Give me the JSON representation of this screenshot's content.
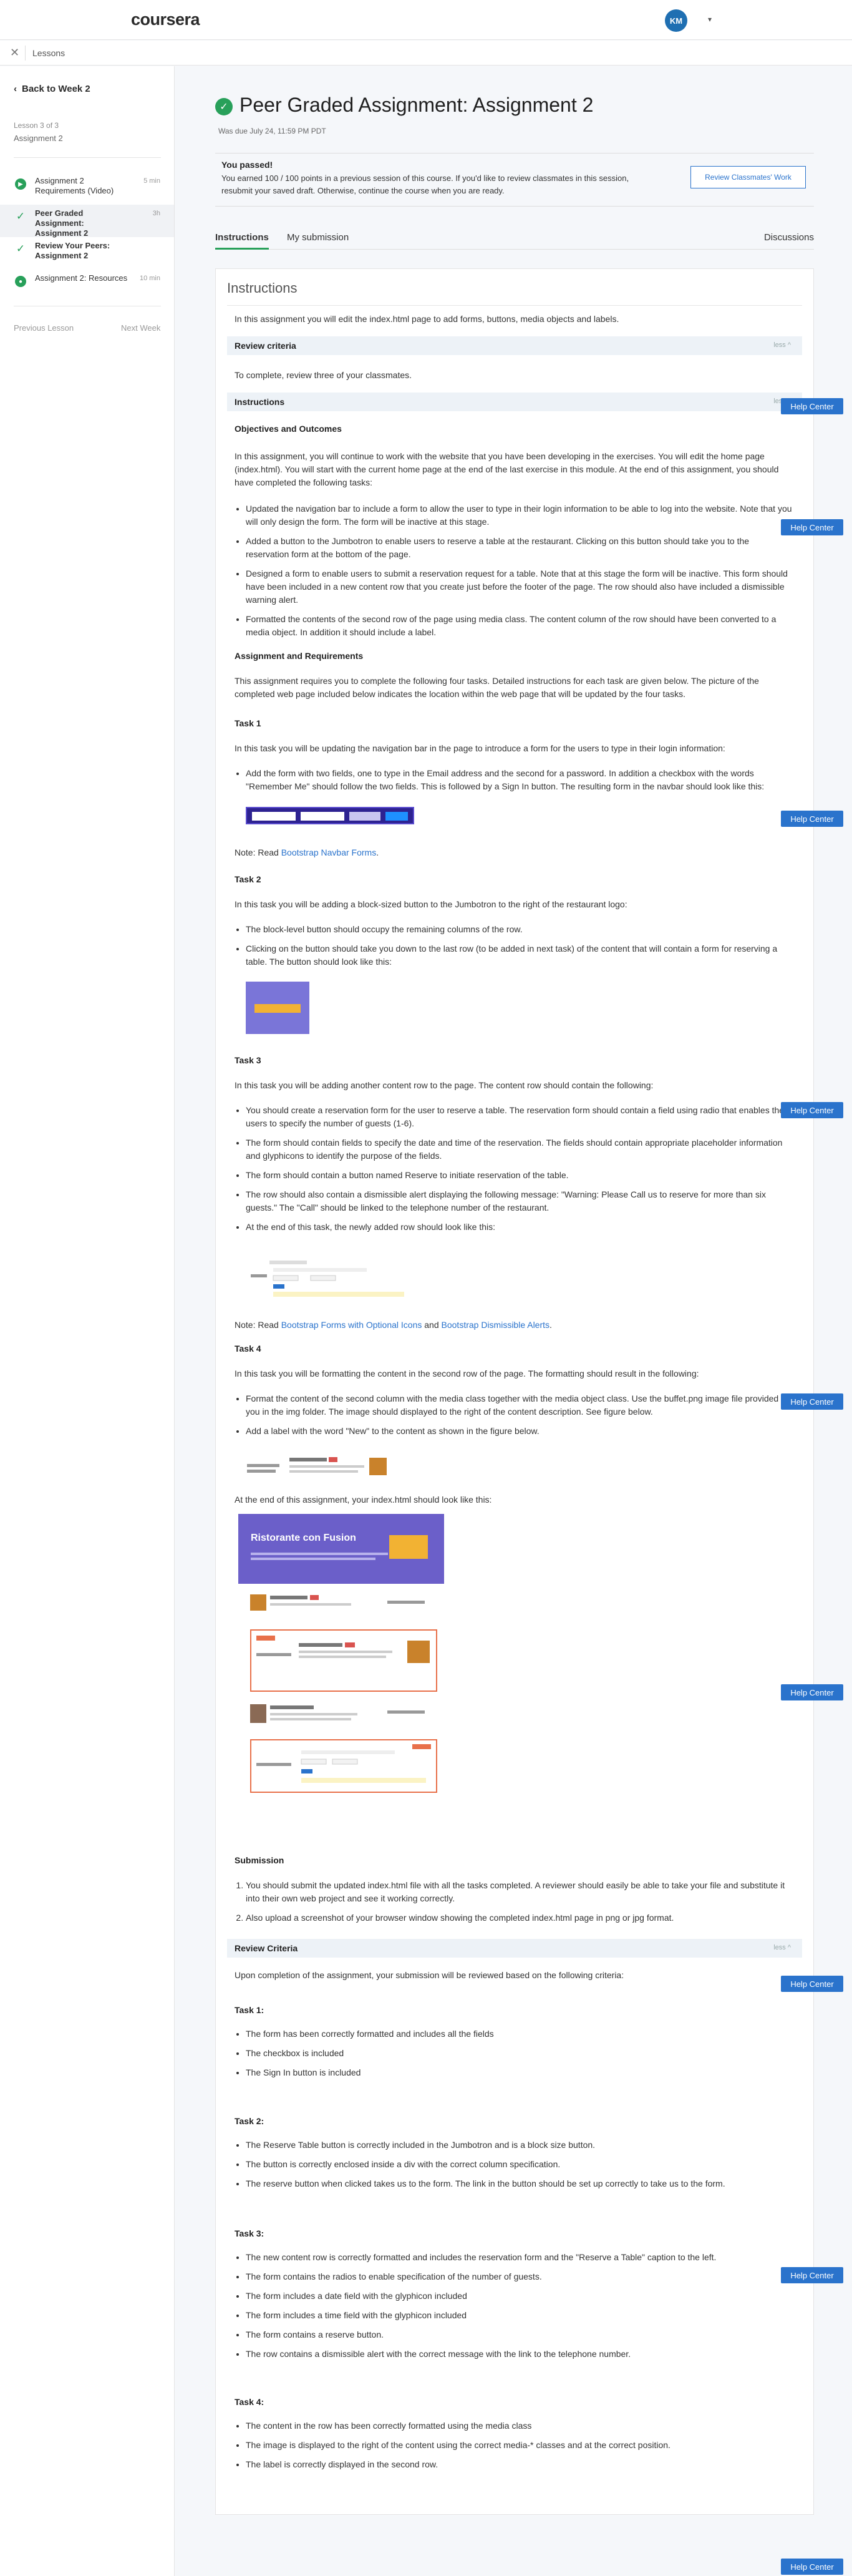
{
  "header": {
    "logo": "coursera",
    "avatar_initials": "KM",
    "avatar_caret": "▾"
  },
  "subbar": {
    "close_icon": "✕",
    "lessons_label": "Lessons"
  },
  "sidebar": {
    "back_label": "Back to Week 2",
    "lesson_meta": "Lesson 3 of 3",
    "lesson_name": "Assignment 2",
    "items": [
      {
        "title": "Assignment 2 Requirements (Video)",
        "duration": "5 min",
        "icon": "play-icon"
      },
      {
        "title": "Peer Graded Assignment: Assignment 2",
        "duration": "3h",
        "icon": "check-icon",
        "active": true
      },
      {
        "title": "Review Your Peers: Assignment 2",
        "duration": "",
        "icon": "check-icon"
      },
      {
        "title": "Assignment 2: Resources",
        "duration": "10 min",
        "icon": "reading-icon"
      }
    ],
    "prev_label": "Previous Lesson",
    "next_label": "Next Week"
  },
  "page": {
    "title": "Peer Graded Assignment: Assignment 2",
    "due": "Was due July 24, 11:59 PM PDT",
    "passed_title": "You passed!",
    "passed_text": "You earned 100 / 100 points in a previous session of this course. If you'd like to review classmates in this session, resubmit your saved draft. Otherwise, continue the course when you are ready.",
    "review_button": "Review Classmates' Work",
    "tabs": [
      "Instructions",
      "My submission"
    ],
    "discussions_tab": "Discussions"
  },
  "content": {
    "heading": "Instructions",
    "intro": "In this assignment you will edit the index.html page to add forms, buttons, media objects and labels.",
    "review_criteria_bar": "Review criteria",
    "less_toggle": "less ^",
    "review_intro": "To complete, review three of your classmates.",
    "instructions_bar": "Instructions",
    "objectives_heading": "Objectives and Outcomes",
    "objectives_text": "In this assignment, you will continue to work with the website that you have been developing in the exercises. You will edit the home page (index.html). You will start with the current home page at the end of the last exercise in this module. At the end of this assignment, you should have completed the following tasks:",
    "objectives_list": [
      "Updated the navigation bar to include a form to allow the user to type in their login information to be able to log into the website. Note that you will only design the form. The form will be inactive at this stage.",
      "Added a button to the Jumbotron to enable users to reserve a table at the restaurant. Clicking on this button should take you to the reservation form at the bottom of the page.",
      "Designed a form to enable users to submit a reservation request for a table. Note that at this stage the form will be inactive. This form should have been included in a new content row that you create just before the footer of the page. The row should also have included a dismissible warning alert.",
      "Formatted the contents of the second row of the page using media class. The content column of the row should have been converted to a media object. In addition it should include a label."
    ],
    "requirements_heading": "Assignment and Requirements",
    "requirements_text": "This assignment requires you to complete the following four tasks. Detailed instructions for each task are given below. The picture of the completed web page included below indicates the location within the web page that will be updated by the four tasks.",
    "task1_heading": "Task 1",
    "task1_text": "In this task you will be updating the navigation bar in the page to introduce a form for the users to type in their login information:",
    "task1_list": [
      "Add the form with two fields, one to type in the Email address and the second for a password. In addition a checkbox with the words \"Remember Me\" should follow the two fields. This is followed by a Sign In button. The resulting form in the navbar should look like this:"
    ],
    "task1_note_prefix": "Note: Read ",
    "task1_note_link": "Bootstrap Navbar Forms",
    "task1_note_suffix": ".",
    "task2_heading": "Task 2",
    "task2_text": "In this task you will be adding a block-sized button to the Jumbotron to the right of the restaurant logo:",
    "task2_list": [
      "The block-level button should occupy the remaining columns of the row.",
      "Clicking on the button should take you down to the last row (to be added in next task) of the content that will contain a form for reserving a table. The button should look like this:"
    ],
    "task3_heading": "Task 3",
    "task3_text": "In this task you will be adding another content row to the page. The content row should contain the following:",
    "task3_list": [
      "You should create a reservation form for the user to reserve a table. The reservation form should contain a field using radio that enables the users to specify the number of guests (1-6).",
      "The form should contain fields to specify the date and time of the reservation. The fields should contain appropriate placeholder information and glyphicons to identify the purpose of the fields.",
      "The form should contain a button named Reserve to initiate reservation of the table.",
      "The row should also contain a dismissible alert displaying the following message: \"Warning: Please Call us to reserve for more than six guests.\" The \"Call\" should be linked to the telephone number of the restaurant.",
      "At the end of this task, the newly added row should look like this:"
    ],
    "task3_note_prefix": "Note: Read ",
    "task3_note_link1": "Bootstrap Forms with Optional Icons",
    "task3_note_mid": " and ",
    "task3_note_link2": "Bootstrap Dismissible Alerts",
    "task3_note_suffix": ".",
    "task4_heading": "Task 4",
    "task4_text": "In this task you will be formatting the content in the second row of the page. The formatting should result in the following:",
    "task4_list": [
      "Format the content of the second column with the media class together with the media object class. Use the buffet.png image file provided for you in the img folder. The image should displayed to the right of the content description. See figure below.",
      "Add a label with the word \"New\" to the content as shown in the figure below."
    ],
    "end_text": "At the end of this assignment, your index.html should look like this:",
    "mock_site_title": "Ristorante con Fusion",
    "submission_heading": "Submission",
    "submission_list": [
      "You should submit the updated index.html file with all the tasks completed. A reviewer should easily be able to take your file and substitute it into their own web project and see it working correctly.",
      "Also upload a screenshot of your browser window showing the completed index.html page in png or jpg format."
    ],
    "review_criteria_bar2": "Review Criteria",
    "criteria_intro": "Upon completion of the assignment, your submission will be reviewed based on the following criteria:",
    "crit_task1_heading": "Task 1:",
    "crit_task1_list": [
      "The form has been correctly formatted and includes all the fields",
      "The checkbox is included",
      "The Sign In button is included"
    ],
    "crit_task2_heading": "Task 2:",
    "crit_task2_list": [
      "The Reserve Table button is correctly included in the Jumbotron and is a block size button.",
      "The button is correctly enclosed inside a div with the correct column specification.",
      "The reserve button when clicked takes us to the form. The link in the button should be set up correctly to take us to the form."
    ],
    "crit_task3_heading": "Task 3:",
    "crit_task3_list": [
      "The new content row is correctly formatted and includes the reservation form and the \"Reserve a Table\" caption to the left.",
      "The form contains the radios to enable specification of the number of guests.",
      "The form includes a date field with the glyphicon included",
      "The form includes a time field with the glyphicon included",
      "The form contains a reserve button.",
      "The row contains a dismissible alert with the correct message with the link to the telephone number."
    ],
    "crit_task4_heading": "Task 4:",
    "crit_task4_list": [
      "The content in the row has been correctly formatted using the media class",
      "The image is displayed to the right of the content using the correct media-* classes and at the correct position.",
      "The label is correctly displayed in the second row."
    ]
  },
  "help_button": "Help Center",
  "colors": {
    "accent_green": "#28a05a",
    "link_blue": "#2a73cc",
    "help_blue": "#2a73cc",
    "navbar_purple": "#2d2291"
  }
}
